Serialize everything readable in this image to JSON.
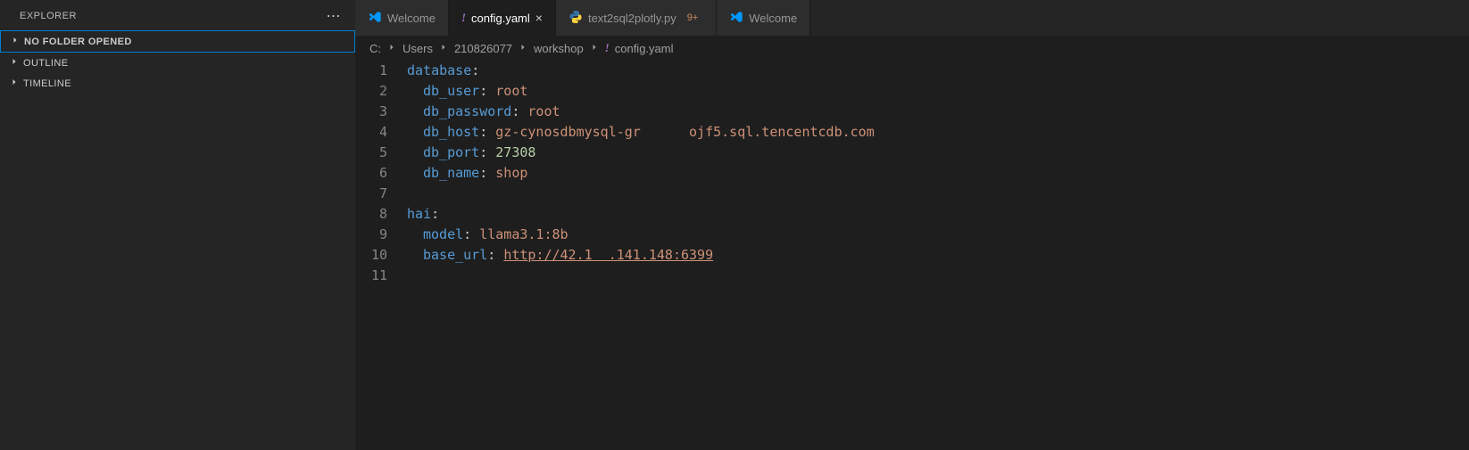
{
  "explorer": {
    "title": "EXPLORER",
    "sections": [
      {
        "label": "NO FOLDER OPENED",
        "active": true
      },
      {
        "label": "OUTLINE",
        "active": false
      },
      {
        "label": "TIMELINE",
        "active": false
      }
    ]
  },
  "tabs": [
    {
      "kind": "vscode",
      "label": "Welcome",
      "active": false,
      "modified": false,
      "badge": ""
    },
    {
      "kind": "yaml",
      "label": "config.yaml",
      "active": true,
      "modified": false,
      "badge": ""
    },
    {
      "kind": "python",
      "label": "text2sql2plotly.py",
      "active": false,
      "modified": true,
      "badge": "9+"
    },
    {
      "kind": "vscode",
      "label": "Welcome",
      "active": false,
      "modified": false,
      "badge": ""
    }
  ],
  "breadcrumb": [
    "C:",
    "Users",
    "210826077",
    "workshop",
    "config.yaml"
  ],
  "breadcrumb_icon_last": "yaml",
  "code": {
    "lines": [
      {
        "n": 1,
        "segs": [
          {
            "t": "database",
            "c": "key"
          },
          {
            "t": ":",
            "c": ""
          }
        ]
      },
      {
        "n": 2,
        "indent": 1,
        "segs": [
          {
            "t": "db_user",
            "c": "key"
          },
          {
            "t": ": ",
            "c": ""
          },
          {
            "t": "root",
            "c": "str"
          }
        ]
      },
      {
        "n": 3,
        "indent": 1,
        "segs": [
          {
            "t": "db_password",
            "c": "key"
          },
          {
            "t": ": ",
            "c": ""
          },
          {
            "t": "root",
            "c": "str"
          }
        ]
      },
      {
        "n": 4,
        "indent": 1,
        "segs": [
          {
            "t": "db_host",
            "c": "key"
          },
          {
            "t": ": ",
            "c": ""
          },
          {
            "t": "gz-cynosdbmysql-gr",
            "c": "str"
          },
          {
            "t": "      ",
            "c": ""
          },
          {
            "t": "ojf5.sql.tencentcdb.com",
            "c": "str"
          }
        ]
      },
      {
        "n": 5,
        "indent": 1,
        "segs": [
          {
            "t": "db_port",
            "c": "key"
          },
          {
            "t": ": ",
            "c": ""
          },
          {
            "t": "27308",
            "c": "num"
          }
        ]
      },
      {
        "n": 6,
        "indent": 1,
        "segs": [
          {
            "t": "db_name",
            "c": "key"
          },
          {
            "t": ": ",
            "c": ""
          },
          {
            "t": "shop",
            "c": "str"
          }
        ]
      },
      {
        "n": 7,
        "segs": []
      },
      {
        "n": 8,
        "segs": [
          {
            "t": "hai",
            "c": "key"
          },
          {
            "t": ":",
            "c": ""
          }
        ]
      },
      {
        "n": 9,
        "indent": 1,
        "segs": [
          {
            "t": "model",
            "c": "key"
          },
          {
            "t": ": ",
            "c": ""
          },
          {
            "t": "llama3.1:8b",
            "c": "str"
          }
        ]
      },
      {
        "n": 10,
        "indent": 1,
        "segs": [
          {
            "t": "base_url",
            "c": "key"
          },
          {
            "t": ": ",
            "c": ""
          },
          {
            "t": "http://42.1  .141.148:6399",
            "c": "url"
          }
        ]
      },
      {
        "n": 11,
        "segs": []
      }
    ]
  }
}
